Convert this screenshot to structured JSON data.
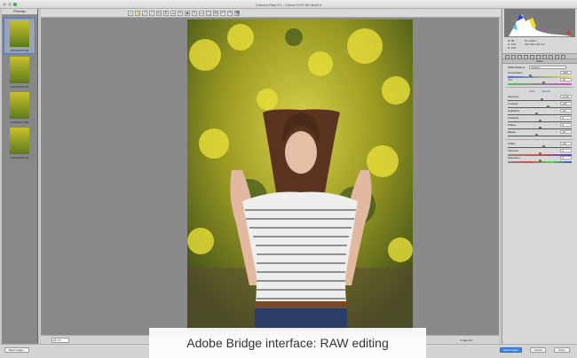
{
  "window": {
    "title": "Camera Raw 9.1 - Canon EOS 5D Mark II"
  },
  "filmstrip": {
    "header": "Filmstrip",
    "items": [
      {
        "label": "0A0A1435.CR2",
        "selected": true
      },
      {
        "label": "0A0A1436.CR2",
        "selected": false
      },
      {
        "label": "0A0A1437.CR2",
        "selected": false
      },
      {
        "label": "0A0A1438.CR2",
        "selected": false
      }
    ]
  },
  "toolbar": {
    "tools": [
      "zoom-icon",
      "hand-icon",
      "white-balance-icon",
      "color-sampler-icon",
      "target-adjust-icon",
      "crop-icon",
      "straighten-icon",
      "spot-removal-icon",
      "red-eye-icon",
      "adjustment-brush-icon",
      "graduated-filter-icon",
      "radial-filter-icon",
      "preferences-icon",
      "rotate-left-icon",
      "rotate-right-icon",
      "trash-icon"
    ]
  },
  "canvas": {
    "zoom": "26.1%",
    "image_count": "Image 1/4"
  },
  "histogram": {
    "r": "R: 88",
    "g": "G: 103",
    "b": "B: 128",
    "aperture": "f/2",
    "shutter": "1/400 s",
    "iso": "ISO 400",
    "focal": "135 mm"
  },
  "basic": {
    "panel_title": "Basic",
    "white_balance_label": "White Balance:",
    "white_balance_value": "Custom",
    "auto": "Auto",
    "default": "Default",
    "wb_sliders": [
      {
        "label": "Temperature",
        "value": "+500",
        "pos": 0.35
      },
      {
        "label": "Tint",
        "value": "+8",
        "pos": 0.55
      }
    ],
    "tone_sliders": [
      {
        "label": "Exposure",
        "value": "+0.30",
        "pos": 0.53
      },
      {
        "label": "Contrast",
        "value": "+25",
        "pos": 0.62
      },
      {
        "label": "Highlights",
        "value": "-10",
        "pos": 0.45
      },
      {
        "label": "Shadows",
        "value": "0",
        "pos": 0.5
      },
      {
        "label": "Whites",
        "value": "0",
        "pos": 0.5
      },
      {
        "label": "Blacks",
        "value": "-10",
        "pos": 0.45
      }
    ],
    "presence_sliders": [
      {
        "label": "Clarity",
        "value": "+10",
        "pos": 0.55
      },
      {
        "label": "Vibrance",
        "value": "0",
        "pos": 0.5
      },
      {
        "label": "Saturation",
        "value": "0",
        "pos": 0.5
      }
    ]
  },
  "bottom": {
    "save": "Save Image...",
    "open": "Open Image",
    "cancel": "Cancel",
    "done": "Done"
  },
  "caption": "Adobe Bridge interface: RAW editing"
}
